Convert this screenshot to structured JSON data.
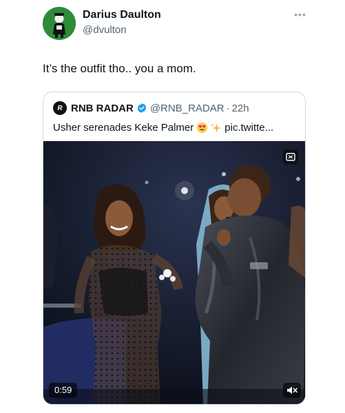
{
  "tweet": {
    "author_name": "Darius Daulton",
    "author_handle": "@dvulton",
    "text": "It’s the outfit tho.. you a mom.",
    "more_icon": "more-horizontal-icon"
  },
  "quote": {
    "account_name": "RNB RADAR",
    "account_handle": "@RNB_RADAR",
    "separator": "·",
    "time": "22h",
    "text": "Usher serenades Keke Palmer",
    "link_text": "pic.twitte...",
    "emojis": [
      "heart-eyes-emoji",
      "sparkles-emoji"
    ],
    "verified_color": "#1d9bf0"
  },
  "video": {
    "duration": "0:59",
    "badge_icon": "gif-badge-icon",
    "mute_icon": "speaker-muted-icon"
  },
  "colors": {
    "avatar_bg": "#2e8b3a",
    "text_primary": "#0f1419",
    "text_secondary": "#536471",
    "border": "#cfd9de"
  }
}
